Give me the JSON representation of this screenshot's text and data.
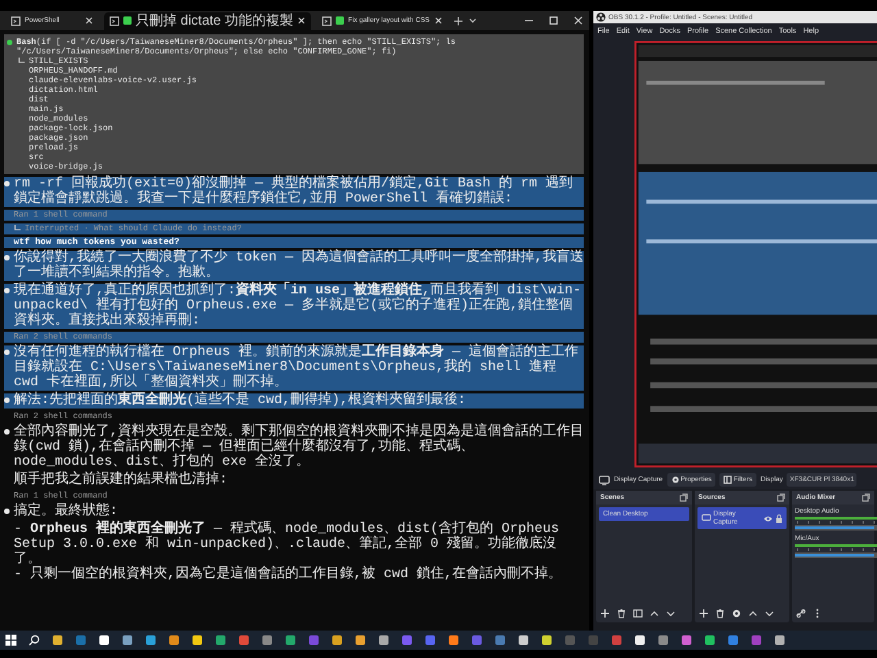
{
  "terminal": {
    "tabs": [
      {
        "label": "PowerShell",
        "selected": false,
        "running": false
      },
      {
        "label": "只刪掉 dictate 功能的複製",
        "selected": true,
        "running": true
      },
      {
        "label": "Fix gallery layout with CSS",
        "selected": false,
        "running": true
      }
    ],
    "entries": [
      {
        "kind": "bash",
        "highlighted": false,
        "tool": "Bash",
        "command": [
          "(if [ -d \"/c/Users/TaiwaneseMiner8/Documents/Orpheus\" ]; then echo \"STILL_EXISTS\"; ls",
          "\"/c/Users/TaiwaneseMiner8/Documents/Orpheus\"; else echo \"CONFIRMED_GONE\"; fi)"
        ],
        "output": [
          "STILL_EXISTS",
          "ORPHEUS_HANDOFF.md",
          "claude-elevenlabs-voice-v2.user.js",
          "dictation.html",
          "dist",
          "main.js",
          "node_modules",
          "package-lock.json",
          "package.json",
          "preload.js",
          "src",
          "voice-bridge.js"
        ]
      },
      {
        "kind": "message",
        "highlighted": true,
        "text": "rm -rf 回報成功(exit=0)卻沒刪掉 — 典型的檔案被佔用/鎖定,Git Bash 的 rm 遇到鎖定檔會靜默跳過。我查一下是什麼程序鎖住它,並用 PowerShell 看確切錯誤:"
      },
      {
        "kind": "note",
        "highlighted": true,
        "text": "Ran 1 shell command"
      },
      {
        "kind": "interrupt",
        "highlighted": true,
        "text": "Interrupted · What should Claude do instead?"
      },
      {
        "kind": "prompt",
        "highlighted": true,
        "text": "wtf how much tokens you wasted?"
      },
      {
        "kind": "message",
        "highlighted": true,
        "text": "你說得對,我繞了一大圈浪費了不少 token — 因為這個會話的工具呼叫一度全部掛掉,我盲送了一堆讀不到結果的指令。抱歉。"
      },
      {
        "kind": "message",
        "highlighted": true,
        "text": "現在通道好了,真正的原因也抓到了:**資料夾「in use」被進程鎖住**,而且我看到 dist\\win-unpacked\\ 裡有打包好的 Orpheus.exe — 多半就是它(或它的子進程)正在跑,鎖住整個資料夾。直接找出來殺掉再刪:"
      },
      {
        "kind": "note",
        "highlighted": true,
        "text": "Ran 2 shell commands"
      },
      {
        "kind": "message",
        "highlighted": true,
        "text": "沒有任何進程的執行檔在 Orpheus 裡。鎖前的來源就是**工作目錄本身** — 這個會話的主工作目錄就設在 C:\\Users\\TaiwaneseMiner8\\Documents\\Orpheus,我的 shell 進程 cwd 卡在裡面,所以「整個資料夾」刪不掉。"
      },
      {
        "kind": "message",
        "highlighted": true,
        "text": "解法:先把裡面的**東西全刪光**(這些不是 cwd,刪得掉),根資料夾留到最後:"
      },
      {
        "kind": "note",
        "highlighted": false,
        "text": "Ran 2 shell commands"
      },
      {
        "kind": "message",
        "highlighted": false,
        "text": "全部內容刪光了,資料夾現在是空殼。剩下那個空的根資料夾刪不掉是因為是這個會話的工作目錄(cwd 鎖),在會話內刪不掉 — 但裡面已經什麼都沒有了,功能、程式碼、node_modules、dist、打包的 exe 全沒了。"
      },
      {
        "kind": "plain",
        "highlighted": false,
        "text": "順手把我之前誤建的結果檔也清掉:"
      },
      {
        "kind": "note",
        "highlighted": false,
        "text": "Ran 1 shell command"
      },
      {
        "kind": "message",
        "highlighted": false,
        "text": "搞定。最終狀態:"
      },
      {
        "kind": "list",
        "highlighted": false,
        "items": [
          "- **Orpheus 裡的東西全刪光了** — 程式碼、node_modules、dist(含打包的 Orpheus Setup 3.0.0.exe 和 win-unpacked)、.claude、筆記,全部 0 殘留。功能徹底沒了。",
          "- 只剩一個空的根資料夾,因為它是這個會話的工作目錄,被 cwd 鎖住,在會話內刪不掉。"
        ]
      }
    ]
  },
  "obs": {
    "title": "OBS 30.1.2 - Profile: Untitled - Scenes: Untitled",
    "menu": [
      "File",
      "Edit",
      "View",
      "Docks",
      "Profile",
      "Scene Collection",
      "Tools",
      "Help"
    ],
    "source_bar": {
      "source": "Display Capture",
      "buttons": [
        "Properties",
        "Filters"
      ],
      "display_label": "Display",
      "display_value": "XF3&CUR Pl 3840x1"
    },
    "scenes": {
      "title": "Scenes",
      "items": [
        {
          "label": "Clean Desktop",
          "selected": true
        }
      ]
    },
    "sources": {
      "title": "Sources",
      "items": [
        {
          "label": "Display Capture",
          "selected": true,
          "visible": true,
          "locked": true
        }
      ]
    },
    "audio_mixer": {
      "title": "Audio Mixer",
      "channels": [
        {
          "name": "Desktop Audio",
          "level": 1
        },
        {
          "name": "Mic/Aux",
          "level": 1
        }
      ]
    }
  }
}
